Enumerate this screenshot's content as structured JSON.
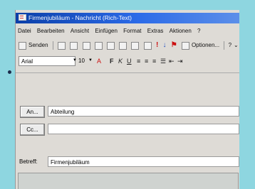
{
  "window": {
    "title": "Firmenjubiläum - Nachricht (Rich-Text)"
  },
  "menu": [
    "Datei",
    "Bearbeiten",
    "Ansicht",
    "Einfügen",
    "Format",
    "Extras",
    "Aktionen",
    "?"
  ],
  "toolbar": {
    "send_label": "Senden",
    "options_label": "Optionen...",
    "help_label": "?"
  },
  "format": {
    "font": "Arial",
    "size": "10",
    "buttons": [
      "A",
      "F",
      "K",
      "U"
    ]
  },
  "header": {
    "to_button": "An...",
    "to_value": "Abteilung",
    "cc_button": "Cc...",
    "cc_value": "",
    "subject_label": "Betreff:",
    "subject_value": "Firmenjubiläum"
  }
}
